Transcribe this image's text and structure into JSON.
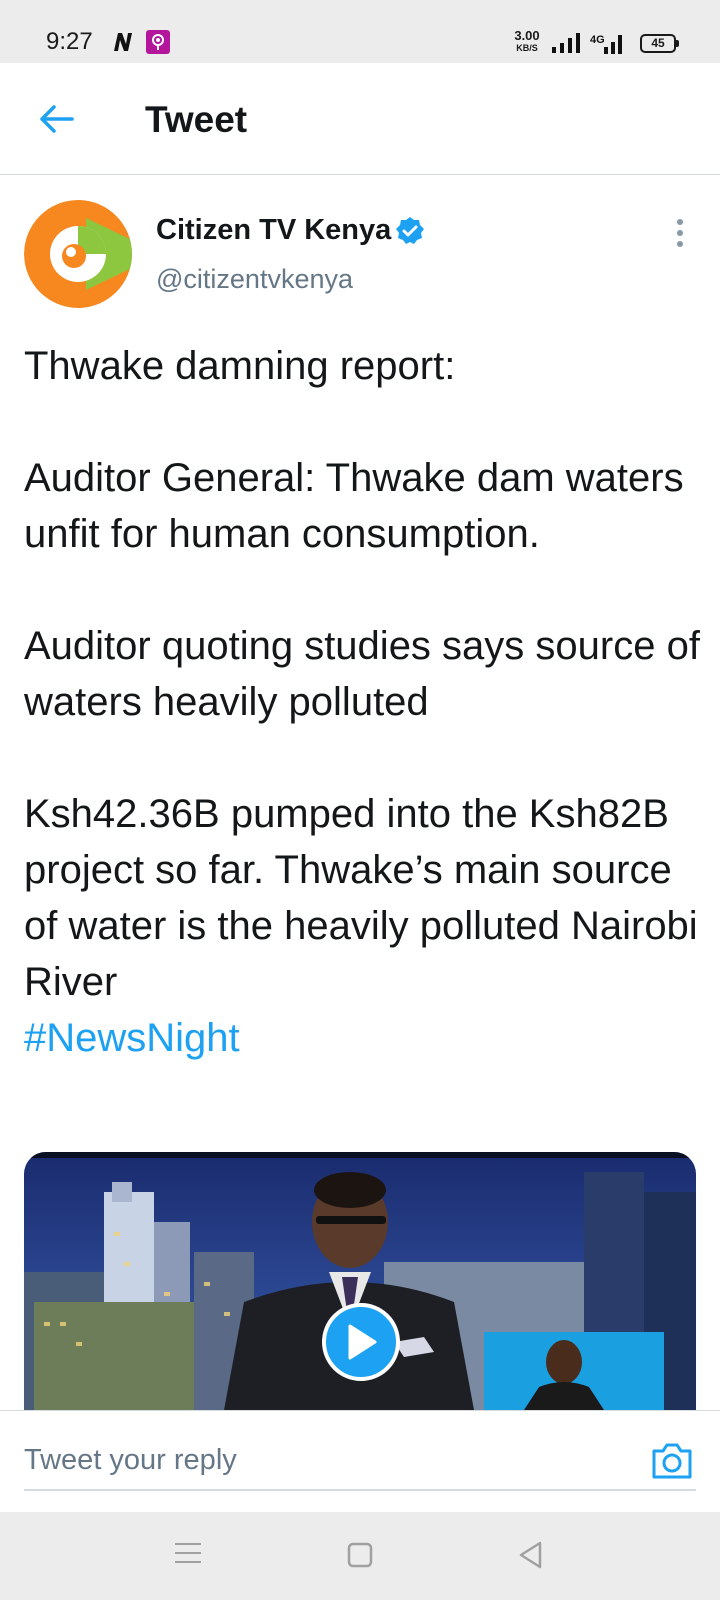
{
  "status_bar": {
    "time": "9:27",
    "net_speed_value": "3.00",
    "net_speed_unit": "KB/S",
    "network_type": "4G",
    "battery": "45",
    "icons": [
      "n-icon",
      "podcast-icon",
      "signal-icon",
      "signal-4g-icon",
      "battery-icon"
    ]
  },
  "header": {
    "title": "Tweet",
    "back_icon": "arrow-left-icon"
  },
  "tweet": {
    "author_name": "Citizen TV Kenya",
    "author_handle": "@citizentvkenya",
    "verified": true,
    "paragraphs": [
      "Thwake damning report:",
      "",
      "Auditor General: Thwake dam waters unfit for human consumption.",
      "",
      "Auditor quoting studies says source of waters heavily polluted",
      "",
      "Ksh42.36B pumped into the Ksh82B project so far. Thwake’s main source of water is the heavily polluted Nairobi River"
    ],
    "hashtag": "#NewsNight",
    "media_type": "video"
  },
  "reply": {
    "placeholder": "Tweet your reply",
    "camera_icon": "camera-icon"
  },
  "nav_bar": {
    "icons": [
      "menu-icon",
      "home-icon",
      "back-icon"
    ]
  },
  "colors": {
    "accent": "#1da1f2",
    "text": "#14171a",
    "secondary_text": "#657786",
    "brand_orange": "#f7871f",
    "brand_green": "#8dc63f"
  }
}
